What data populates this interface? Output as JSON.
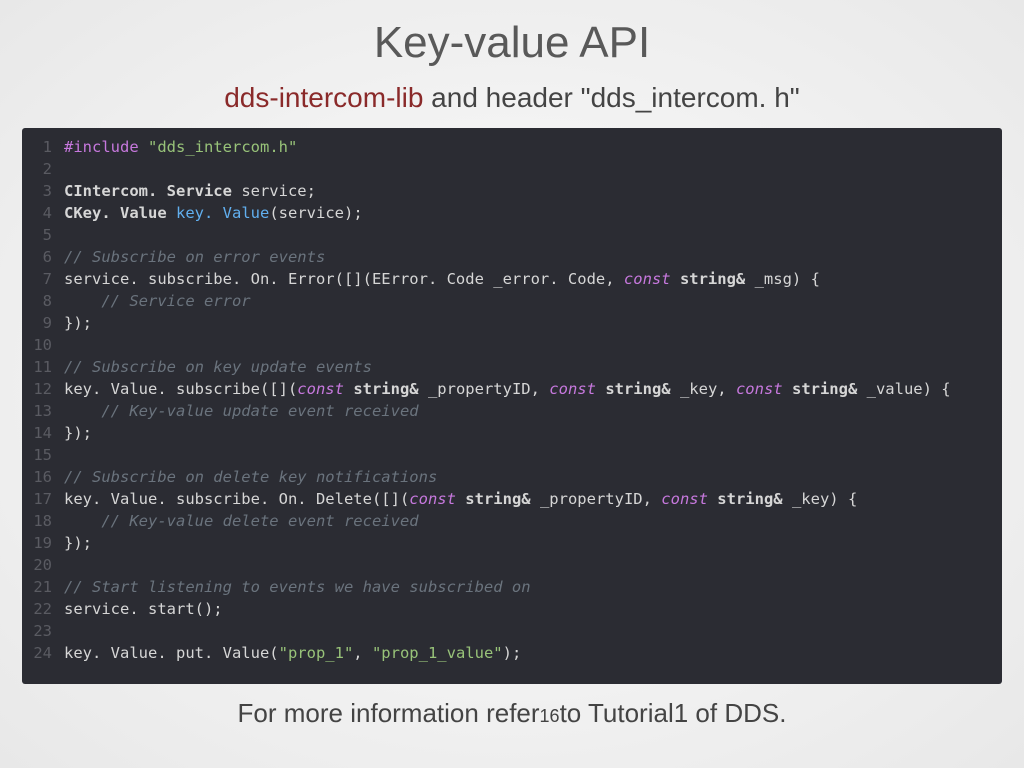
{
  "title": "Key-value API",
  "subtitle": {
    "lib": "dds-intercom-lib",
    "rest": " and header \"dds_intercom. h\""
  },
  "footer": {
    "pre": "For more information refer",
    "pg": "16",
    "post": "to Tutorial1 of DDS."
  },
  "code": [
    {
      "n": 1,
      "seg": [
        [
          "dir",
          "#include"
        ],
        [
          "",
          " "
        ],
        [
          "str",
          "\"dds_intercom.h\""
        ]
      ]
    },
    {
      "n": 2,
      "seg": []
    },
    {
      "n": 3,
      "seg": [
        [
          "type",
          "CIntercom. Service"
        ],
        [
          "",
          " service;"
        ]
      ]
    },
    {
      "n": 4,
      "seg": [
        [
          "type",
          "CKey. Value"
        ],
        [
          "",
          " "
        ],
        [
          "fn",
          "key. Value"
        ],
        [
          "",
          "(service);"
        ]
      ]
    },
    {
      "n": 5,
      "seg": []
    },
    {
      "n": 6,
      "seg": [
        [
          "com",
          "// Subscribe on error events"
        ]
      ]
    },
    {
      "n": 7,
      "seg": [
        [
          "",
          "service. subscribe. On. Error([](EError. Code _error. Code, "
        ],
        [
          "kw",
          "const"
        ],
        [
          "",
          " "
        ],
        [
          "type",
          "string&"
        ],
        [
          "",
          " _msg) {"
        ]
      ]
    },
    {
      "n": 8,
      "seg": [
        [
          "",
          "    "
        ],
        [
          "com",
          "// Service error"
        ]
      ]
    },
    {
      "n": 9,
      "seg": [
        [
          "",
          "});"
        ]
      ]
    },
    {
      "n": 10,
      "seg": []
    },
    {
      "n": 11,
      "seg": [
        [
          "com",
          "// Subscribe on key update events"
        ]
      ]
    },
    {
      "n": 12,
      "seg": [
        [
          "",
          "key. Value. subscribe([]("
        ],
        [
          "kw",
          "const"
        ],
        [
          "",
          " "
        ],
        [
          "type",
          "string&"
        ],
        [
          "",
          " _propertyID, "
        ],
        [
          "kw",
          "const"
        ],
        [
          "",
          " "
        ],
        [
          "type",
          "string&"
        ],
        [
          "",
          " _key, "
        ],
        [
          "kw",
          "const"
        ],
        [
          "",
          " "
        ],
        [
          "type",
          "string&"
        ],
        [
          "",
          " _value) {"
        ]
      ]
    },
    {
      "n": 13,
      "seg": [
        [
          "",
          "    "
        ],
        [
          "com",
          "// Key-value update event received"
        ]
      ]
    },
    {
      "n": 14,
      "seg": [
        [
          "",
          "});"
        ]
      ]
    },
    {
      "n": 15,
      "seg": []
    },
    {
      "n": 16,
      "seg": [
        [
          "com",
          "// Subscribe on delete key notifications"
        ]
      ]
    },
    {
      "n": 17,
      "seg": [
        [
          "",
          "key. Value. subscribe. On. Delete([]("
        ],
        [
          "kw",
          "const"
        ],
        [
          "",
          " "
        ],
        [
          "type",
          "string&"
        ],
        [
          "",
          " _propertyID, "
        ],
        [
          "kw",
          "const"
        ],
        [
          "",
          " "
        ],
        [
          "type",
          "string&"
        ],
        [
          "",
          " _key) {"
        ]
      ]
    },
    {
      "n": 18,
      "seg": [
        [
          "",
          "    "
        ],
        [
          "com",
          "// Key-value delete event received"
        ]
      ]
    },
    {
      "n": 19,
      "seg": [
        [
          "",
          "});"
        ]
      ]
    },
    {
      "n": 20,
      "seg": []
    },
    {
      "n": 21,
      "seg": [
        [
          "com",
          "// Start listening to events we have subscribed on"
        ]
      ]
    },
    {
      "n": 22,
      "seg": [
        [
          "",
          "service. start();"
        ]
      ]
    },
    {
      "n": 23,
      "seg": []
    },
    {
      "n": 24,
      "seg": [
        [
          "",
          "key. Value. put. Value("
        ],
        [
          "str",
          "\"prop_1\""
        ],
        [
          "",
          ", "
        ],
        [
          "str",
          "\"prop_1_value\""
        ],
        [
          "",
          ");"
        ]
      ]
    }
  ]
}
